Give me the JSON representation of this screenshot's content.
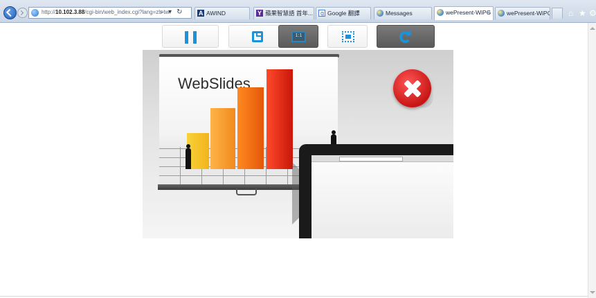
{
  "browser": {
    "url_prefix": "http://",
    "url_host": "10.102.3.88",
    "url_path": "/cgi-bin/web_index.cgi?lang=zh-tw",
    "address_buttons": {
      "search": "⌕",
      "dropdown": "▾",
      "refresh": "↻"
    },
    "tabs": [
      {
        "label": "AWIND",
        "icon": "awind-icon"
      },
      {
        "label": "蘋果智慧語 首年...",
        "icon": "yahoo-icon"
      },
      {
        "label": "Google 翻譯",
        "icon": "google-translate-icon"
      },
      {
        "label": "Messages",
        "icon": "ie-icon"
      },
      {
        "label": "wePresent-WiPG",
        "icon": "ie-icon",
        "active": true,
        "close": "×"
      },
      {
        "label": "wePresent-WiPG",
        "icon": "ie-icon"
      }
    ],
    "command_icons": {
      "home": "⌂",
      "favorites": "★",
      "settings": "⚙"
    }
  },
  "toolbar": {
    "ratio_label": "1:1",
    "buttons": [
      {
        "name": "pause-button",
        "icon": "pause-icon"
      },
      {
        "name": "save-button",
        "icon": "save-icon"
      },
      {
        "name": "ratio-button",
        "icon": "ratio-icon",
        "state": "active"
      },
      {
        "name": "fullscreen-button",
        "icon": "fullscreen-icon"
      },
      {
        "name": "refresh-button",
        "icon": "refresh-icon",
        "state": "active"
      }
    ]
  },
  "preview": {
    "slide_title": "WebSlides",
    "close_icon": "close-badge-icon"
  },
  "colors": {
    "accent": "#1a93d8",
    "button_active": "#666666",
    "close_red": "#d41f1f",
    "chrome": "#d3ddea"
  }
}
